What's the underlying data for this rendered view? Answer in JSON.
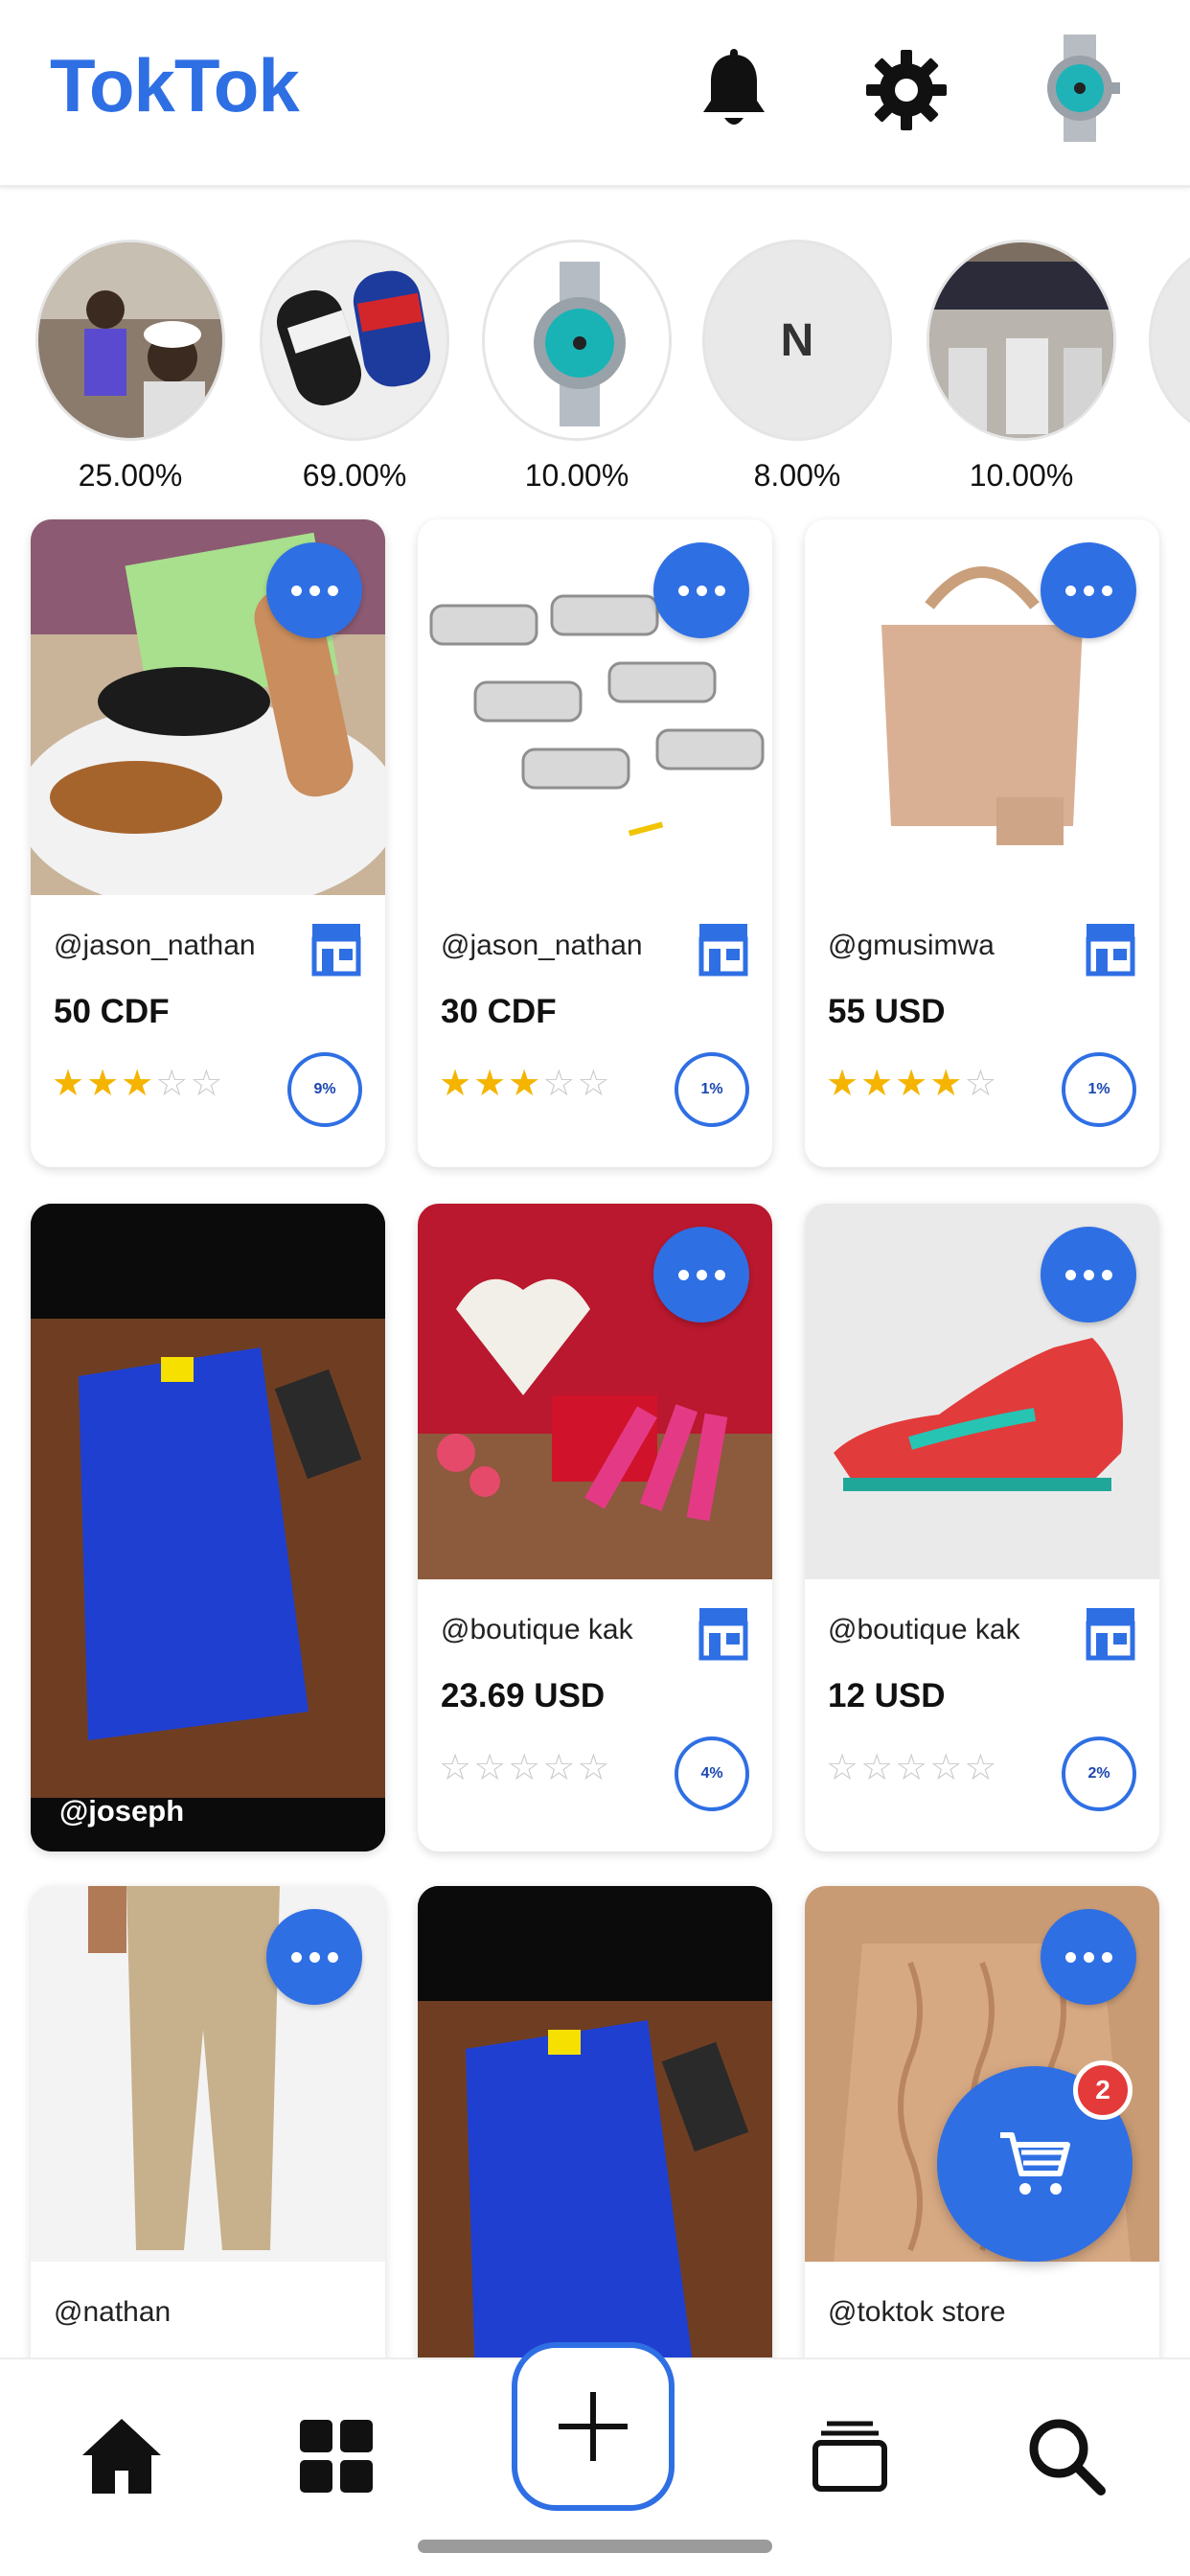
{
  "app": {
    "title": "TokTok"
  },
  "header": {
    "icons": [
      "bell-icon",
      "gear-icon"
    ],
    "avatar": "watch-avatar"
  },
  "colors": {
    "accent": "#2f6fe4",
    "star": "#f4b400",
    "badge": "#e43a3a"
  },
  "stories": [
    {
      "label": "25.00%",
      "image": "people-photo"
    },
    {
      "label": "69.00%",
      "image": "slides-photo"
    },
    {
      "label": "10.00%",
      "image": "watch-photo"
    },
    {
      "label": "8.00%",
      "initial": "N"
    },
    {
      "label": "10.00%",
      "image": "store-photo"
    }
  ],
  "products": [
    {
      "user": "@jason_nathan",
      "price": "50 CDF",
      "rating": 3,
      "percent": "9%",
      "image": "sandals"
    },
    {
      "user": "@jason_nathan",
      "price": "30 CDF",
      "rating": 3,
      "percent": "1%",
      "image": "chafing-dishes"
    },
    {
      "user": "@gmusimwa",
      "price": "55 USD",
      "rating": 4,
      "percent": "1%",
      "image": "handbag"
    },
    {
      "overlay_user": "@joseph",
      "image": "blue-shorts"
    },
    {
      "user": "@boutique kak",
      "price": "23.69 USD",
      "rating": 0,
      "percent": "4%",
      "image": "valentine-gifts"
    },
    {
      "user": "@boutique kak",
      "price": "12 USD",
      "rating": 0,
      "percent": "2%",
      "image": "football-boot"
    },
    {
      "user": "@nathan",
      "image": "khaki-pants"
    },
    {
      "image": "blue-shorts-2"
    },
    {
      "user": "@toktok store",
      "image": "sweater"
    }
  ],
  "cart": {
    "count": "2"
  },
  "nav": [
    "home-icon",
    "grid-icon",
    "add-icon",
    "layers-icon",
    "search-icon"
  ]
}
